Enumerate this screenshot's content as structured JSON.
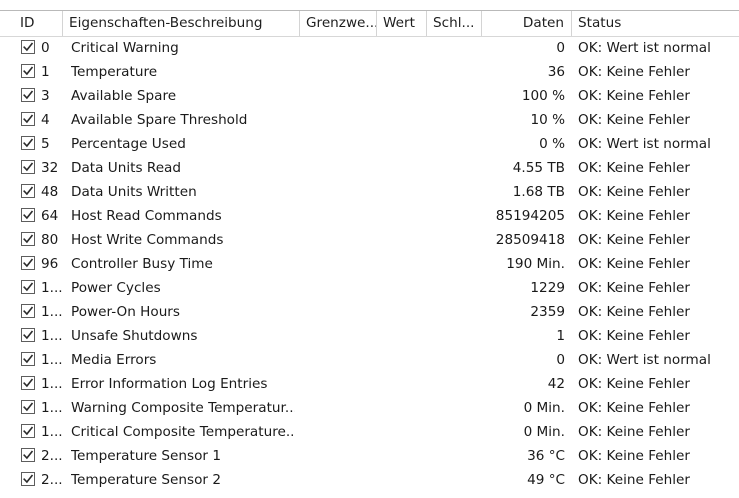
{
  "columns": {
    "id": "ID",
    "description": "Eigenschaften-Beschreibung",
    "threshold": "Grenzwe...",
    "value": "Wert",
    "key": "Schl...",
    "data": "Daten",
    "status": "Status"
  },
  "rows": [
    {
      "id": "0",
      "description": "Critical Warning",
      "data": "0",
      "status": "OK: Wert ist normal",
      "checked": true
    },
    {
      "id": "1",
      "description": "Temperature",
      "data": "36",
      "status": "OK: Keine Fehler",
      "checked": true
    },
    {
      "id": "3",
      "description": "Available Spare",
      "data": "100 %",
      "status": "OK: Keine Fehler",
      "checked": true
    },
    {
      "id": "4",
      "description": "Available Spare Threshold",
      "data": "10 %",
      "status": "OK: Keine Fehler",
      "checked": true
    },
    {
      "id": "5",
      "description": "Percentage Used",
      "data": "0 %",
      "status": "OK: Wert ist normal",
      "checked": true
    },
    {
      "id": "32",
      "description": "Data Units Read",
      "data": "4.55 TB",
      "status": "OK: Keine Fehler",
      "checked": true
    },
    {
      "id": "48",
      "description": "Data Units Written",
      "data": "1.68 TB",
      "status": "OK: Keine Fehler",
      "checked": true
    },
    {
      "id": "64",
      "description": "Host Read Commands",
      "data": "85194205",
      "status": "OK: Keine Fehler",
      "checked": true
    },
    {
      "id": "80",
      "description": "Host Write Commands",
      "data": "28509418",
      "status": "OK: Keine Fehler",
      "checked": true
    },
    {
      "id": "96",
      "description": "Controller Busy Time",
      "data": "190 Min.",
      "status": "OK: Keine Fehler",
      "checked": true
    },
    {
      "id": "1...",
      "description": "Power Cycles",
      "data": "1229",
      "status": "OK: Keine Fehler",
      "checked": true
    },
    {
      "id": "1...",
      "description": "Power-On Hours",
      "data": "2359",
      "status": "OK: Keine Fehler",
      "checked": true
    },
    {
      "id": "1...",
      "description": "Unsafe Shutdowns",
      "data": "1",
      "status": "OK: Keine Fehler",
      "checked": true
    },
    {
      "id": "1...",
      "description": "Media Errors",
      "data": "0",
      "status": "OK: Wert ist normal",
      "checked": true
    },
    {
      "id": "1...",
      "description": "Error Information Log Entries",
      "data": "42",
      "status": "OK: Keine Fehler",
      "checked": true
    },
    {
      "id": "1...",
      "description": "Warning Composite Temperatur...",
      "data": "0 Min.",
      "status": "OK: Keine Fehler",
      "checked": true
    },
    {
      "id": "1...",
      "description": "Critical Composite Temperature...",
      "data": "0 Min.",
      "status": "OK: Keine Fehler",
      "checked": true
    },
    {
      "id": "2...",
      "description": "Temperature Sensor 1",
      "data": "36 °C",
      "status": "OK: Keine Fehler",
      "checked": true
    },
    {
      "id": "2...",
      "description": "Temperature Sensor 2",
      "data": "49 °C",
      "status": "OK: Keine Fehler",
      "checked": true
    }
  ],
  "icons": {
    "checkbox": "checkbox-checked-icon"
  }
}
